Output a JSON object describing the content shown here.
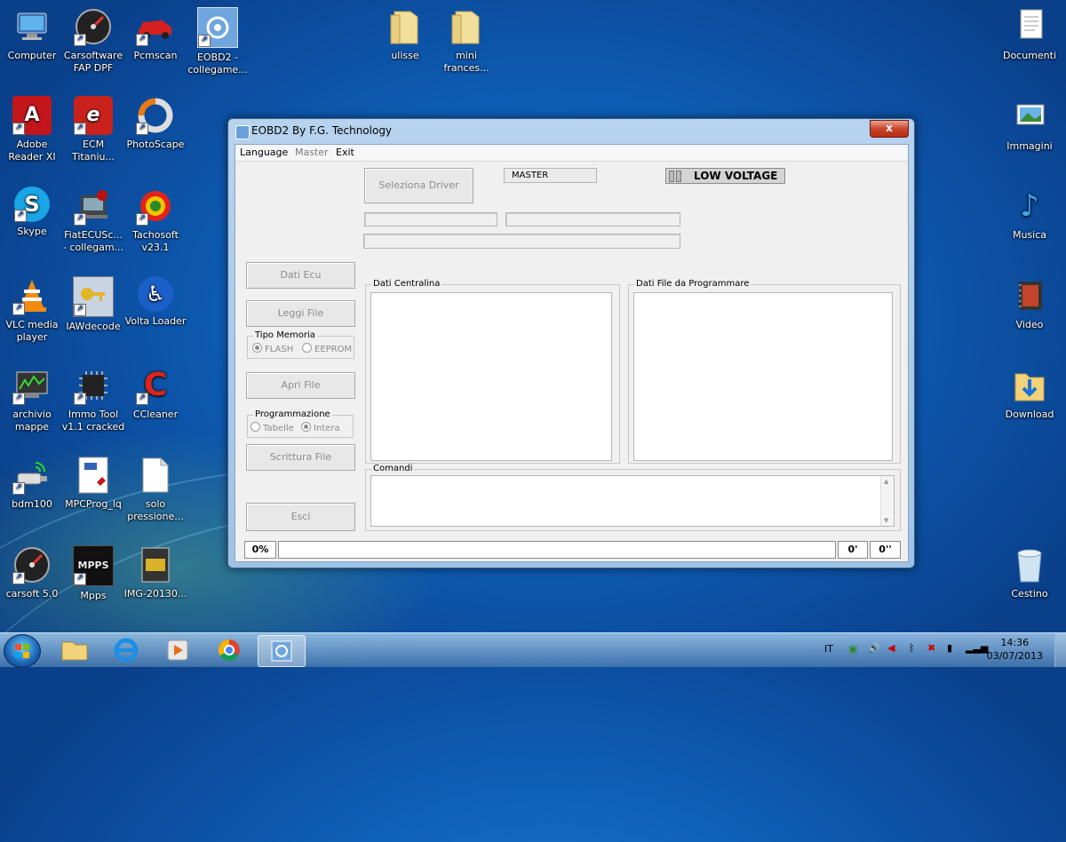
{
  "desktop": {
    "left_icons": [
      {
        "label": "Computer"
      },
      {
        "label": "Carsoftware FAP DPF"
      },
      {
        "label": "Pcmscan"
      },
      {
        "label": "EOBD2 - collegame..."
      },
      {
        "label": "Adobe Reader XI"
      },
      {
        "label": "ECM Titaniu..."
      },
      {
        "label": "PhotoScape"
      },
      {
        "label": "Skype"
      },
      {
        "label": "FiatECUSc... - collegam..."
      },
      {
        "label": "Tachosoft v23.1"
      },
      {
        "label": "VLC media player"
      },
      {
        "label": "IAWdecode"
      },
      {
        "label": "Volta Loader"
      },
      {
        "label": "archivio mappe"
      },
      {
        "label": "Immo Tool v1.1 cracked"
      },
      {
        "label": "CCleaner"
      },
      {
        "label": "bdm100"
      },
      {
        "label": "MPCProg_lq"
      },
      {
        "label": "solo pressione..."
      },
      {
        "label": "carsoft 5.0"
      },
      {
        "label": "Mpps"
      },
      {
        "label": "IMG-20130..."
      }
    ],
    "top_folders": [
      {
        "label": "ulisse"
      },
      {
        "label": "mini frances..."
      }
    ],
    "right_icons": [
      {
        "label": "Documenti"
      },
      {
        "label": "Immagini"
      },
      {
        "label": "Musica"
      },
      {
        "label": "Video"
      },
      {
        "label": "Download"
      },
      {
        "label": "Cestino"
      }
    ]
  },
  "window": {
    "title": "EOBD2 By F.G. Technology",
    "close_label": "x",
    "menu": {
      "language": "Language",
      "master": "Master",
      "exit": "Exit"
    },
    "buttons": {
      "seleziona_driver": "Seleziona Driver",
      "dati_ecu": "Dati Ecu",
      "leggi_file": "Leggi File",
      "apri_file": "Apri File",
      "scrittura_file": "Scrittura File",
      "esci": "Esci"
    },
    "master_label": "MASTER",
    "low_voltage_label": "LOW VOLTAGE",
    "tipo_memoria": {
      "title": "Tipo Memoria",
      "flash": "FLASH",
      "eeprom": "EEPROM",
      "selected": "FLASH"
    },
    "programmazione": {
      "title": "Programmazione",
      "tabelle": "Tabelle",
      "intera": "Intera",
      "selected": "Intera"
    },
    "groups": {
      "dati_centralina": "Dati Centralina",
      "dati_file": "Dati File da Programmare",
      "comandi": "Comandi"
    },
    "status": {
      "percent": "0%",
      "minutes": "0'",
      "seconds": "0''"
    }
  },
  "taskbar": {
    "language": "IT",
    "time": "14:36",
    "date": "03/07/2013",
    "pinned": [
      "explorer-icon",
      "internet-explorer-icon",
      "media-player-icon",
      "chrome-icon",
      "eobd2-app-icon"
    ]
  }
}
